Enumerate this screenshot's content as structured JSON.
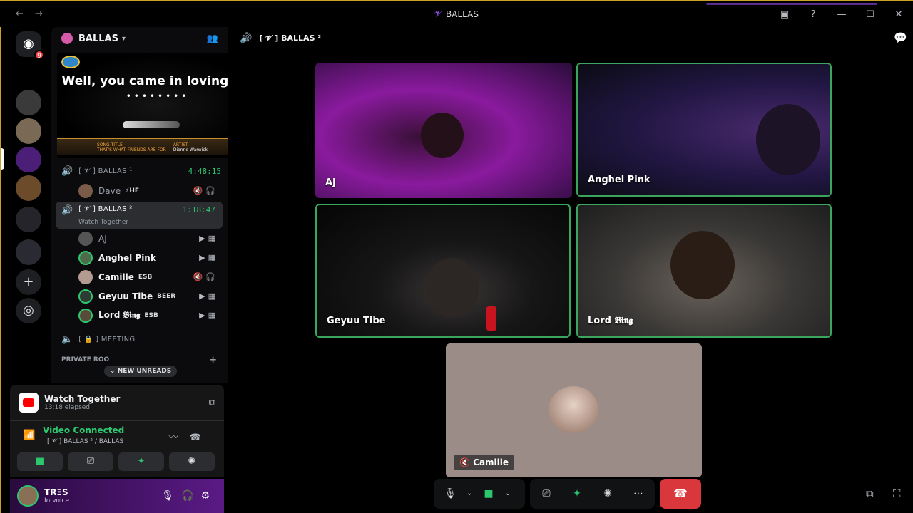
{
  "window": {
    "title": "BALLAS",
    "nav": "← →",
    "icons": [
      "screen-share-icon",
      "help-icon",
      "minimize-icon",
      "maximize-icon",
      "close-icon"
    ]
  },
  "rail": {
    "discord_badge": "9"
  },
  "guild": {
    "name": "BALLAS"
  },
  "karaoke": {
    "lyric": "Well, you came in loving me",
    "dots": "••••••••",
    "song_label": "SONG TITLE",
    "song": "THAT'S WHAT FRIENDS ARE FOR",
    "artist_label": "ARTIST",
    "artist": "Dionne Warwick"
  },
  "channels": {
    "vc1": {
      "name": "[ 𝓥 ] BALLAS ¹",
      "time": "4:48:15"
    },
    "vc1_users": [
      {
        "name": "Dave",
        "tag": "⚡HF"
      }
    ],
    "vc2": {
      "name": "[ 𝓥 ] BALLAS ²",
      "time": "1:18:47",
      "sub": "Watch Together"
    },
    "vc2_users": [
      {
        "name": "AJ",
        "tag": ""
      },
      {
        "name": "Anghel Pink",
        "tag": ""
      },
      {
        "name": "Camille",
        "tag": "ESB"
      },
      {
        "name": "Geyuu Tibe",
        "tag": "BEER"
      },
      {
        "name": "Lord 𝕭𝖎𝖓𝖌",
        "tag": "ESB"
      }
    ],
    "vc3": {
      "name": "[ 🔒 ] MEETING"
    },
    "category": "PRIVATE ROO",
    "new_unreads": "NEW UNREADS"
  },
  "watch_panel": {
    "title": "Watch Together",
    "elapsed": "13:18 elapsed"
  },
  "voice_panel": {
    "status": "Video Connected",
    "channel": "[ 𝓥 ] BALLAS ² / BALLAS"
  },
  "user_panel": {
    "name": "TRΞS",
    "status": "In voice"
  },
  "main": {
    "channel": "[ 𝓥 ] BALLAS ²",
    "tiles": {
      "aj": "AJ",
      "anghel": "Anghel Pink",
      "geyuu": "Geyuu Tibe",
      "lord": "Lord 𝕭𝖎𝖓𝖌",
      "camille": "Camille"
    }
  },
  "colors": {
    "accent_green": "#2dc770",
    "end_call_red": "#da373c"
  }
}
